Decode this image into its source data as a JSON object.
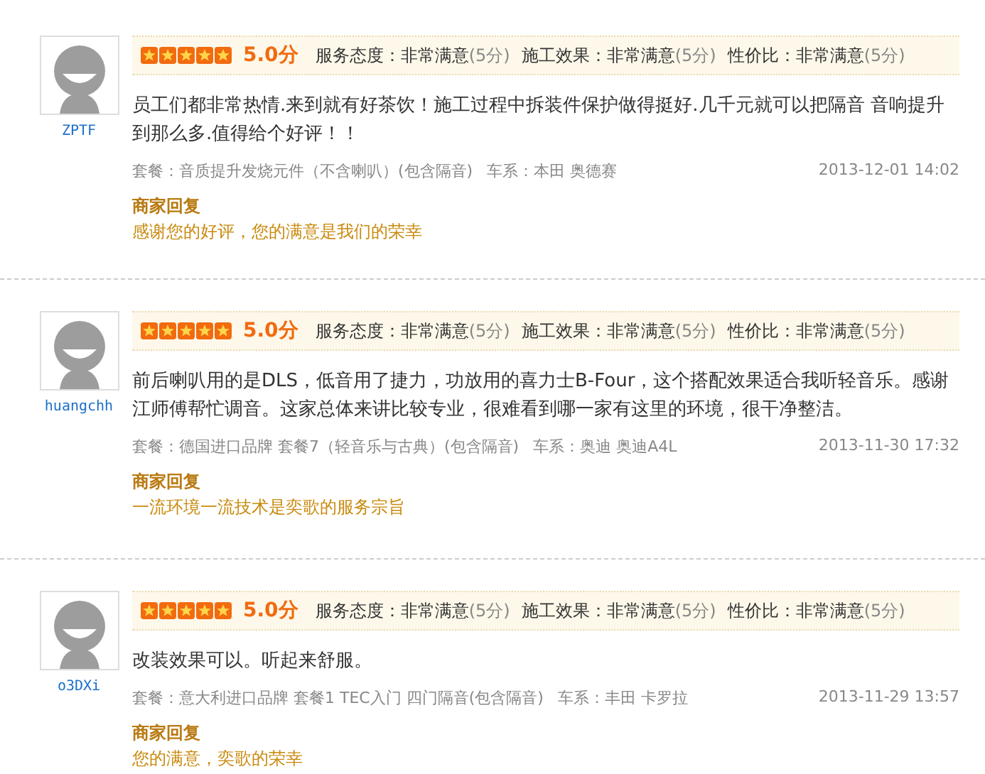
{
  "reviews": [
    {
      "user": "ZPTF",
      "stars": 5,
      "score": "5.0分",
      "ratings": [
        {
          "label": "服务态度：",
          "value": "非常满意",
          "points": "(5分)"
        },
        {
          "label": "施工效果：",
          "value": "非常满意",
          "points": "(5分)"
        },
        {
          "label": "性价比：",
          "value": "非常满意",
          "points": "(5分)"
        }
      ],
      "text": "员工们都非常热情.来到就有好茶饮！施工过程中拆装件保护做得挺好.几千元就可以把隔音 音响提升到那么多.值得给个好评！！",
      "package": "套餐：音质提升发烧元件（不含喇叭）(包含隔音)",
      "car": "车系：本田 奥德赛",
      "date": "2013-12-01 14:02",
      "reply_title": "商家回复",
      "reply": "感谢您的好评，您的满意是我们的荣幸"
    },
    {
      "user": "huangchh",
      "stars": 5,
      "score": "5.0分",
      "ratings": [
        {
          "label": "服务态度：",
          "value": "非常满意",
          "points": "(5分)"
        },
        {
          "label": "施工效果：",
          "value": "非常满意",
          "points": "(5分)"
        },
        {
          "label": "性价比：",
          "value": "非常满意",
          "points": "(5分)"
        }
      ],
      "text": "前后喇叭用的是DLS，低音用了捷力，功放用的喜力士B-Four，这个搭配效果适合我听轻音乐。感谢江师傅帮忙调音。这家总体来讲比较专业，很难看到哪一家有这里的环境，很干净整洁。",
      "package": "套餐：德国进口品牌 套餐7（轻音乐与古典）(包含隔音)",
      "car": "车系：奥迪 奥迪A4L",
      "date": "2013-11-30 17:32",
      "reply_title": "商家回复",
      "reply": "一流环境一流技术是奕歌的服务宗旨"
    },
    {
      "user": "o3DXi",
      "stars": 5,
      "score": "5.0分",
      "ratings": [
        {
          "label": "服务态度：",
          "value": "非常满意",
          "points": "(5分)"
        },
        {
          "label": "施工效果：",
          "value": "非常满意",
          "points": "(5分)"
        },
        {
          "label": "性价比：",
          "value": "非常满意",
          "points": "(5分)"
        }
      ],
      "text": "改装效果可以。听起来舒服。",
      "package": "套餐：意大利进口品牌 套餐1 TEC入门 四门隔音(包含隔音)",
      "car": "车系：丰田 卡罗拉",
      "date": "2013-11-29 13:57",
      "reply_title": "商家回复",
      "reply": "您的满意，奕歌的荣幸"
    }
  ]
}
